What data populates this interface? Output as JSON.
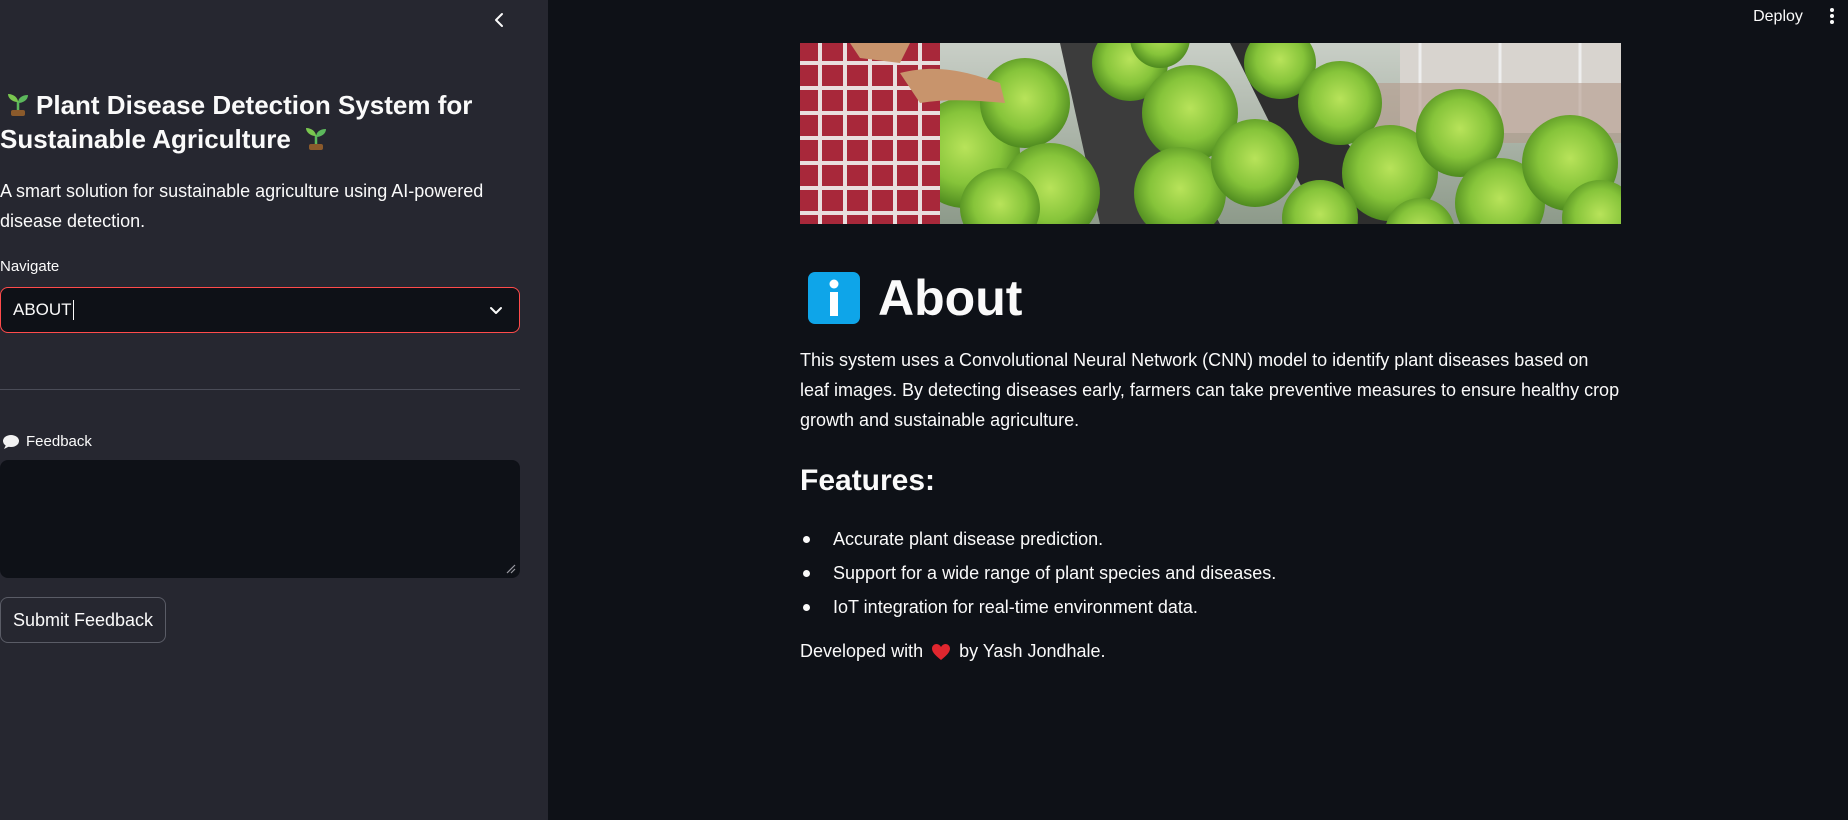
{
  "sidebar": {
    "title_part1": "Plant Disease Detection System for",
    "title_part2": "Sustainable Agriculture",
    "tagline": "A smart solution for sustainable agriculture using AI-powered disease detection.",
    "nav_label": "Navigate",
    "nav_selected": "ABOUT",
    "feedback_label": "Feedback",
    "feedback_value": "",
    "submit_label": "Submit Feedback"
  },
  "header": {
    "deploy_label": "Deploy"
  },
  "main": {
    "heading": "About",
    "paragraph": "This system uses a Convolutional Neural Network (CNN) model to identify plant diseases based on leaf images. By detecting diseases early, farmers can take preventive measures to ensure healthy crop growth and sustainable agriculture.",
    "features_heading": "Features:",
    "features": [
      "Accurate plant disease prediction.",
      "Support for a wide range of plant species and diseases.",
      "IoT integration for real-time environment data."
    ],
    "footer_prefix": "Developed with",
    "footer_suffix": "by Yash Jondhale."
  },
  "colors": {
    "app_bg": "#0e1117",
    "sidebar_bg": "#262730",
    "accent": "#ff4b4b",
    "info_blue": "#0ea5e9"
  },
  "icons": {
    "collapse": "chevron-left-icon",
    "select": "chevron-down-icon",
    "sprout": "seedling-icon",
    "feedback": "speech-balloon-icon",
    "menu": "vertical-dots-icon",
    "info": "information-icon",
    "heart": "heart-icon"
  }
}
